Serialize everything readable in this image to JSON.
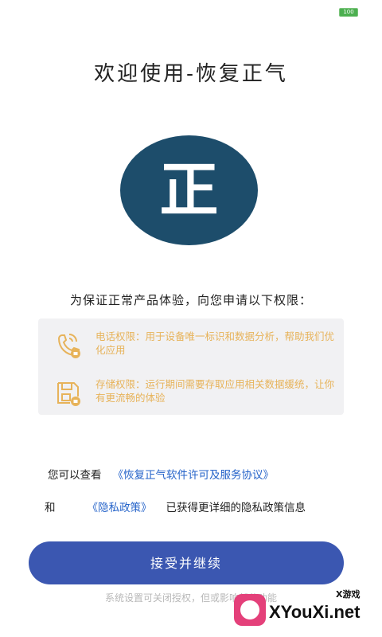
{
  "status_bar": {
    "battery": "100"
  },
  "header": {
    "title": "欢迎使用-恢复正气"
  },
  "logo": {
    "char": "正"
  },
  "intro": {
    "text": "为保证正常产品体验，向您申请以下权限："
  },
  "permissions": [
    {
      "icon": "phone-icon",
      "text": "电话权限：用于设备唯一标识和数据分析，帮助我们优化应用"
    },
    {
      "icon": "storage-icon",
      "text": "存储权限：运行期间需要存取应用相关数据缓统，让你有更流畅的体验"
    }
  ],
  "agreement": {
    "line1_prefix": "您可以查看",
    "license_link": "《恢复正气软件许可及服务协议》",
    "line2_prefix": "和",
    "privacy_link": "《隐私政策》",
    "line2_suffix": "已获得更详细的隐私政策信息"
  },
  "button": {
    "label": "接受并继续"
  },
  "footer": {
    "note": "系统设置可关闭授权，但或影响部分功能"
  },
  "watermark": {
    "sub": "X游戏",
    "main": "XYouXi.net"
  },
  "colors": {
    "brand_blue": "#1d4d6b",
    "button": "#3b57b1",
    "link": "#2563c9",
    "permission_text": "#e7b35a"
  }
}
